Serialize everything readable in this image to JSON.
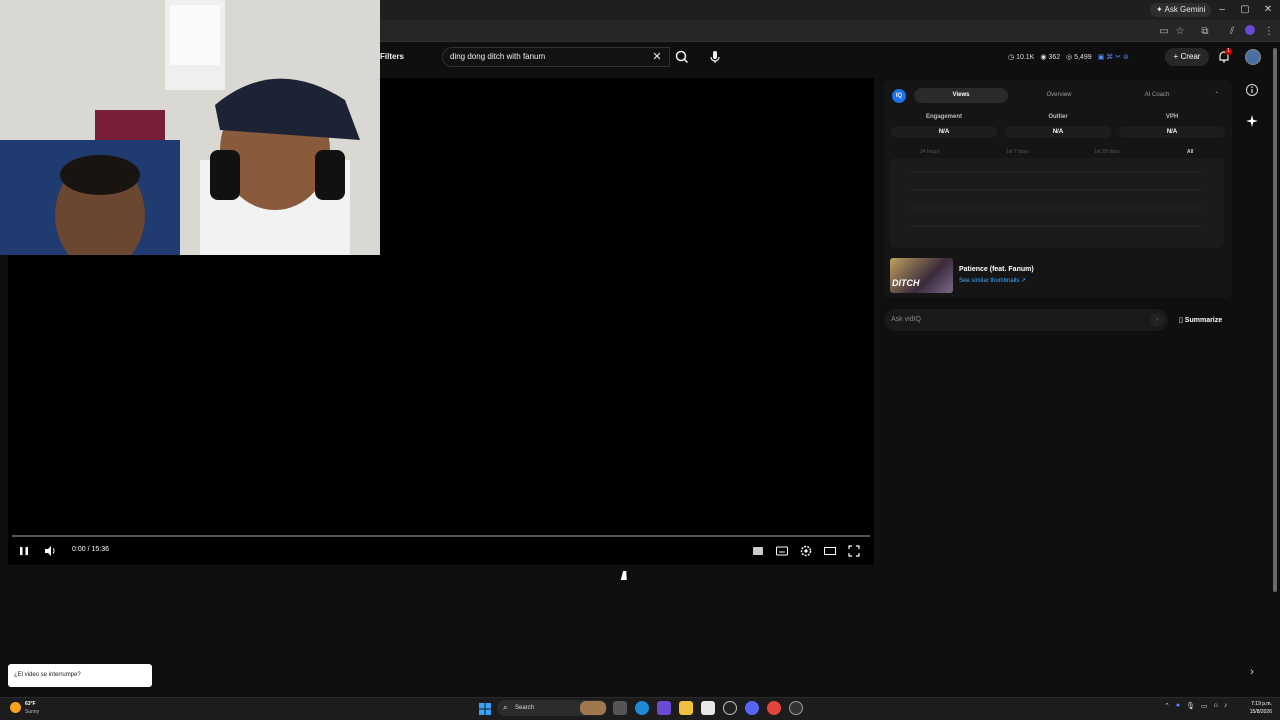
{
  "browser": {
    "gemini_label": "Ask Gemini",
    "window_controls": [
      "–",
      "▢",
      "✕"
    ]
  },
  "header": {
    "filters_label": "Filters",
    "search_value": "ding dong ditch with fanum",
    "stats": [
      "10.1K",
      "362",
      "5,499"
    ],
    "create_label": "Crear",
    "notification_count": "1"
  },
  "player": {
    "time": "0:00 / 15:36",
    "progress_fraction": 0.0
  },
  "vidiq": {
    "logo": "IQ",
    "tabs": [
      "Views",
      "Overview",
      "AI Coach"
    ],
    "metrics": [
      {
        "label": "Engagement",
        "value": "N/A"
      },
      {
        "label": "Outlier",
        "value": "N/A"
      },
      {
        "label": "VPH",
        "value": "N/A"
      }
    ],
    "ranges": [
      "24 hours",
      "1st 7 days",
      "1st 28 days",
      "All"
    ],
    "thumbnail_title": "Patience (feat. Fanum)",
    "thumbnail_link": "See similar thumbnails ↗",
    "thumbnail_text": "DITCH",
    "ask_placeholder": "Ask vidIQ",
    "summarize_label": "Summarize"
  },
  "toast": {
    "text": "¿El video se interrumpe?"
  },
  "taskbar": {
    "weather_temp": "63°F",
    "weather_condition": "Sunny",
    "search_label": "Search",
    "clock_time": "7:19 p.m.",
    "clock_date": "15/8/2026"
  },
  "colors": {
    "accent_blue": "#1a73e8",
    "link_blue": "#3ea6ff",
    "badge_red": "#cc0000"
  }
}
